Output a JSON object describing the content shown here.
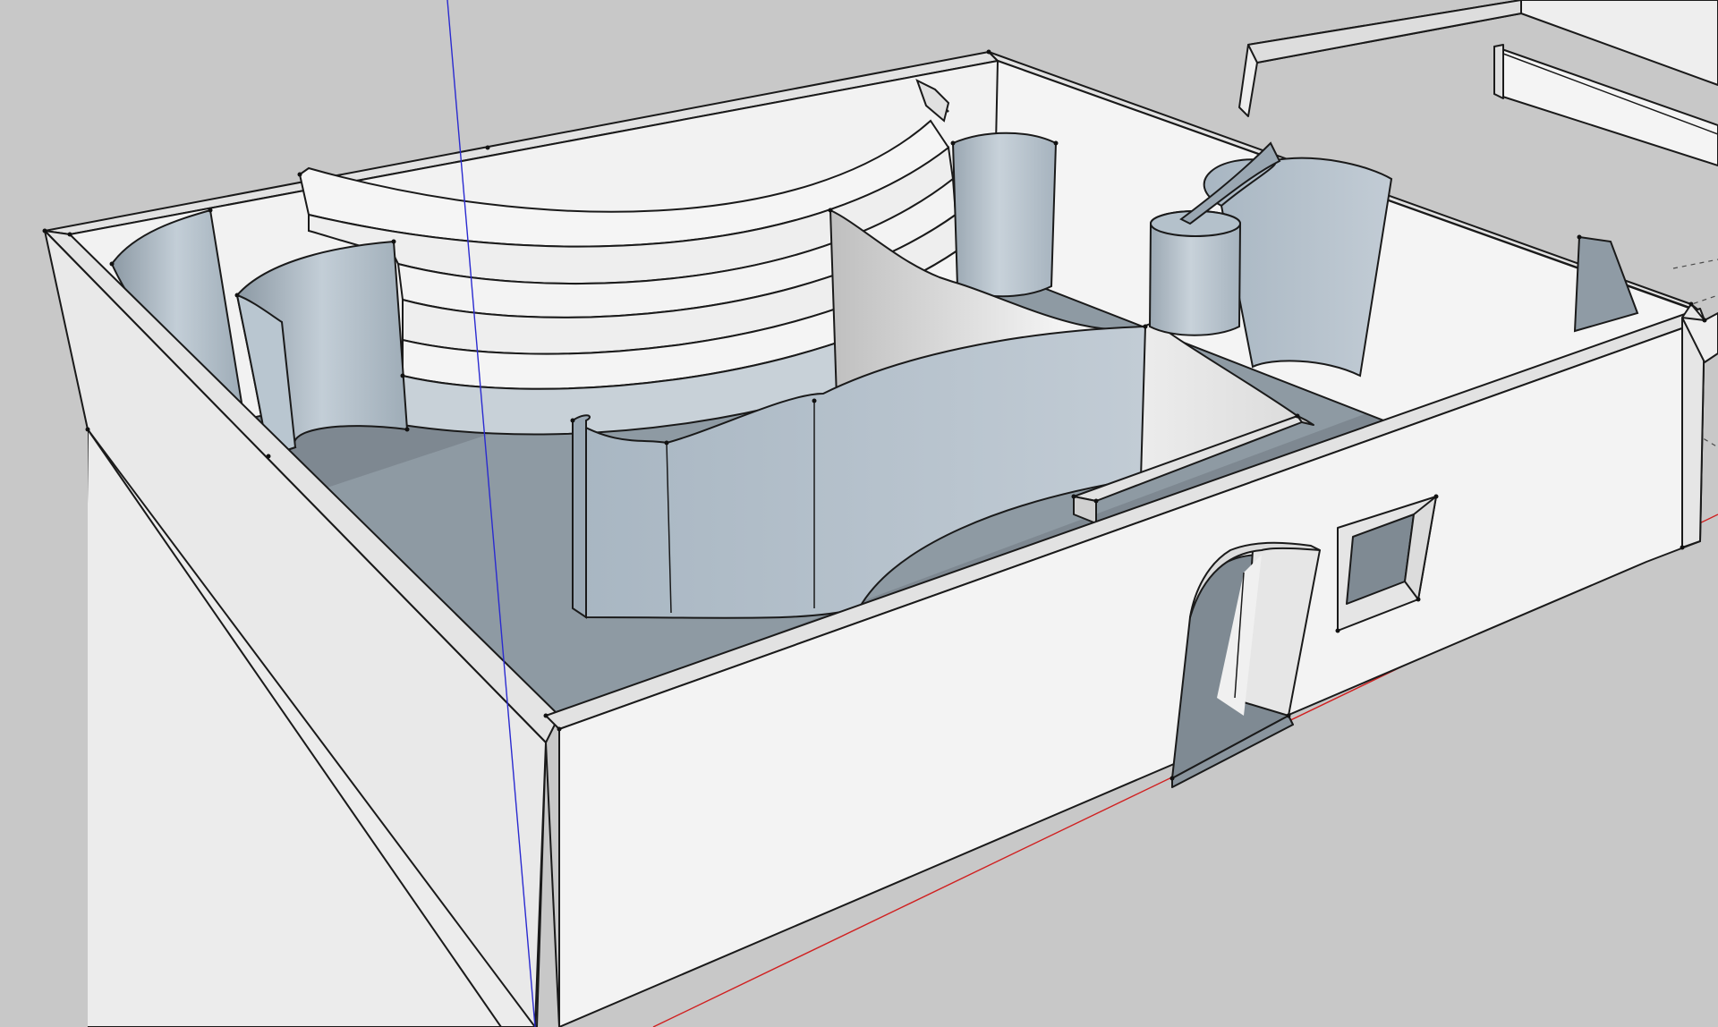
{
  "app": {
    "kind": "3d-modeling-viewport"
  },
  "colors": {
    "ground": "#c8c8c8",
    "wall_face": "#f3f3f3",
    "wall_top": "#e4e4e4",
    "wall_shadow": "#d6d6d6",
    "floor_shadow": "#7f8a93",
    "floor_light": "#98a6b1",
    "curved_wall": "#aebcc8",
    "curved_wall_dark": "#8996a1",
    "edge": "#1a1a1a",
    "axis_red": "#d02020",
    "axis_green": "#20a020",
    "axis_blue": "#2020c0",
    "guide": "#555555"
  },
  "axes": [
    {
      "name": "red-axis",
      "icon": "red-axis-line"
    },
    {
      "name": "green-axis",
      "icon": "green-axis-line"
    },
    {
      "name": "blue-axis",
      "icon": "blue-axis-line"
    }
  ],
  "model": {
    "components": [
      "outer-walls",
      "interior-partition",
      "curved-walls",
      "cylindrical-columns",
      "spiral-ribbons",
      "arched-doorway",
      "square-window",
      "adjacent-room"
    ]
  }
}
